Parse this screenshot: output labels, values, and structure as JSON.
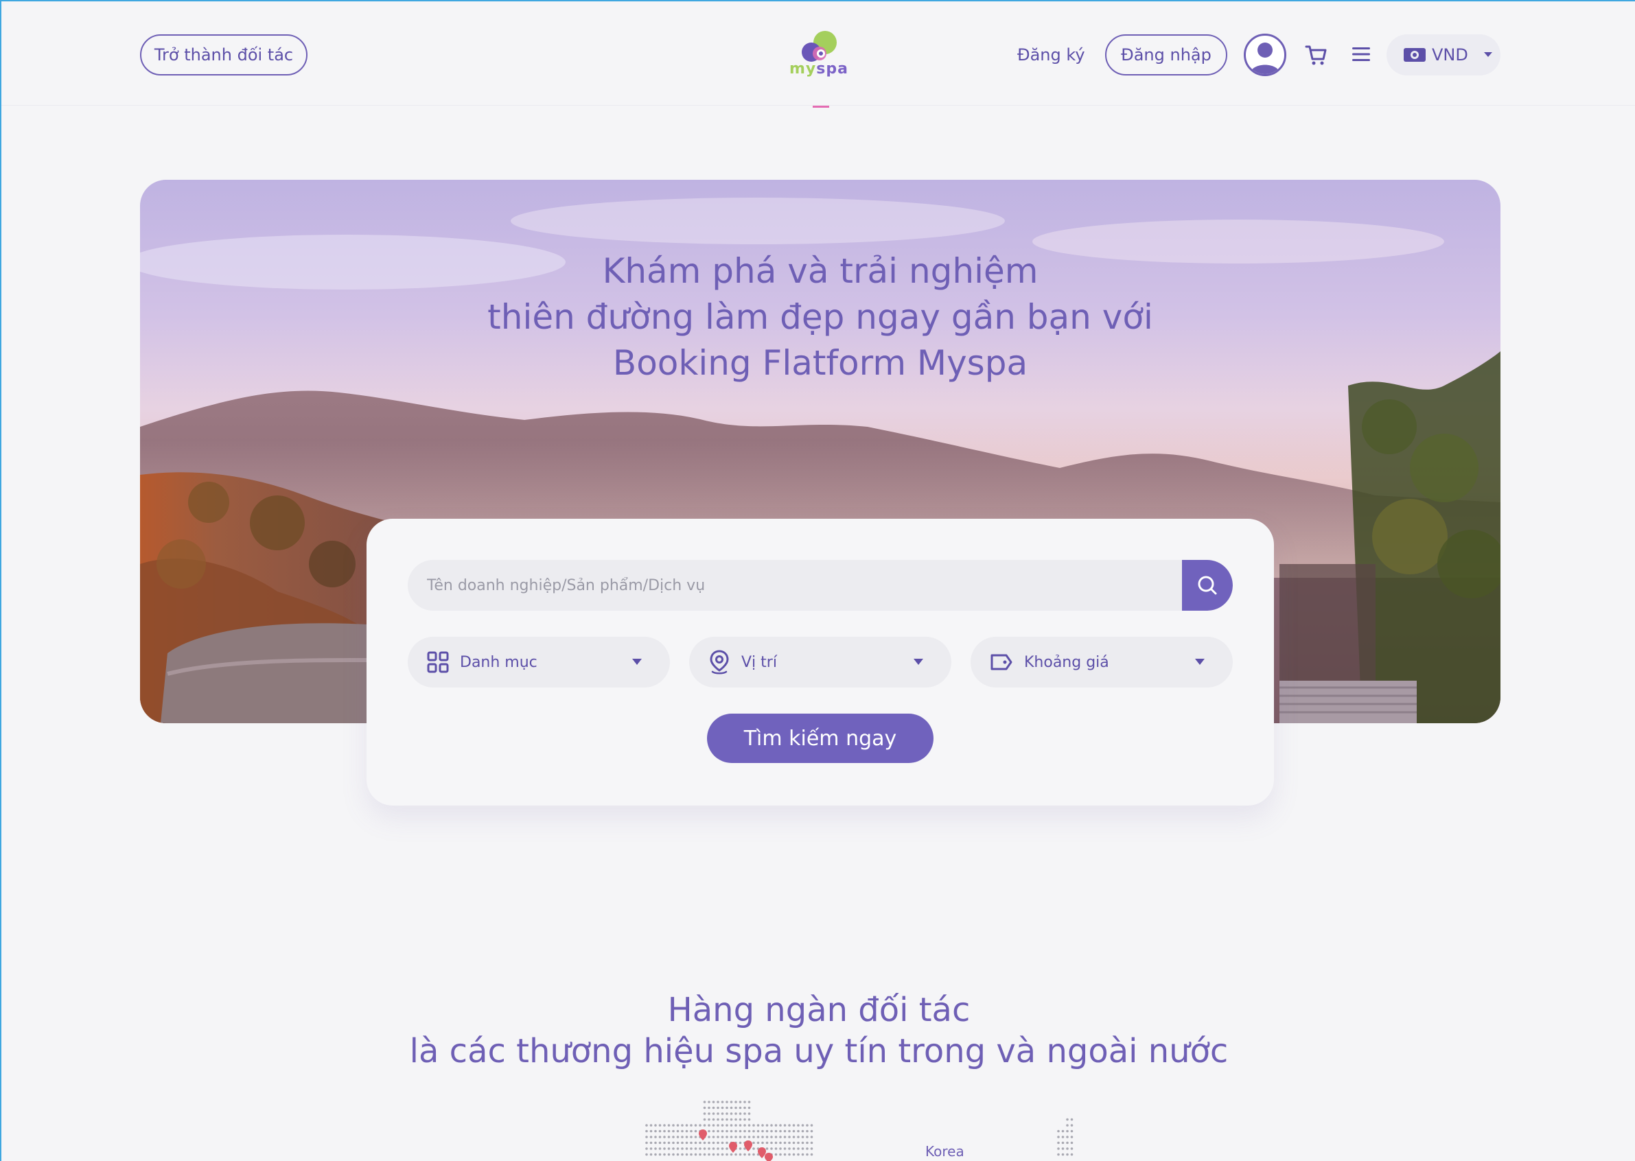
{
  "header": {
    "partner_label": "Trở thành đối tác",
    "register_label": "Đăng ký",
    "login_label": "Đăng nhập",
    "logo": {
      "my": "my",
      "spa": "spa"
    },
    "currency": "VND",
    "icons": [
      "user-avatar-icon",
      "cart-icon",
      "menu-icon",
      "money-icon",
      "caret-down-icon"
    ]
  },
  "hero": {
    "title_line1": "Khám phá và trải nghiệm",
    "title_line2": "thiên đường làm đẹp ngay gần bạn với",
    "title_line3": "Booking Flatform Myspa"
  },
  "search": {
    "placeholder": "Tên doanh nghiệp/Sản phẩm/Dịch vụ",
    "filters": [
      {
        "label": "Danh mục",
        "icon": "grid-icon"
      },
      {
        "label": "Vị trí",
        "icon": "location-pin-icon"
      },
      {
        "label": "Khoảng giá",
        "icon": "price-tag-icon"
      }
    ],
    "submit_label": "Tìm kiếm ngay"
  },
  "partners": {
    "title_line1": "Hàng ngàn đối tác",
    "title_line2": "là các thương hiệu spa uy tín trong và ngoài nước",
    "map_label": "Korea"
  },
  "colors": {
    "primary": "#7062bd",
    "logo_green": "#a4cf5c",
    "accent_pink": "#e46cb2",
    "background": "#f5f5f7"
  }
}
